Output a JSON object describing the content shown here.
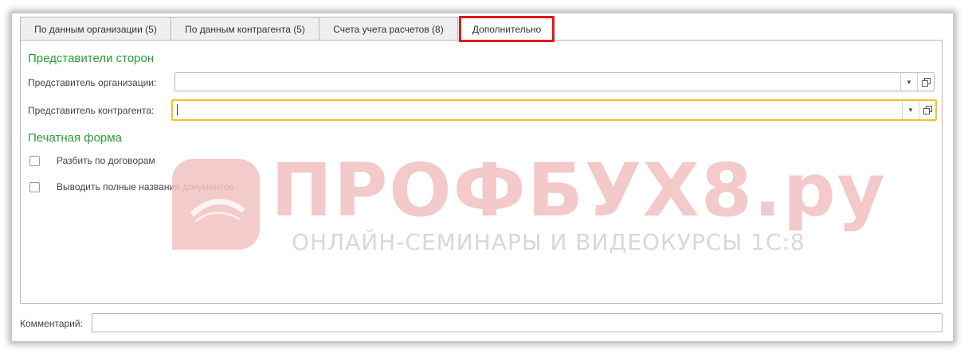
{
  "tabs": [
    {
      "label": "По данным организации (5)"
    },
    {
      "label": "По данным контрагента (5)"
    },
    {
      "label": "Счета учета расчетов (8)"
    },
    {
      "label": "Дополнительно"
    }
  ],
  "representatives": {
    "title": "Представители сторон",
    "organization_label": "Представитель организации:",
    "organization_value": "",
    "counterparty_label": "Представитель контрагента:",
    "counterparty_value": ""
  },
  "print_form": {
    "title": "Печатная форма",
    "split_by_contracts_label": "Разбить по договорам",
    "split_by_contracts_checked": false,
    "full_doc_names_label": "Выводить полные названия документов",
    "full_doc_names_checked": false
  },
  "comment": {
    "label": "Комментарий:",
    "value": ""
  },
  "watermark": {
    "title": "ПРОФБУХ8.ру",
    "subtitle": "ОНЛАЙН-СЕМИНАРЫ И ВИДЕОКУРСЫ 1С:8"
  },
  "icons": {
    "dropdown": "chevron-down-icon",
    "open": "open-form-icon"
  },
  "colors": {
    "section_title": "#2e9b3c",
    "active_tab_highlight": "#e01a1a",
    "focus_border": "#f2c21b"
  }
}
